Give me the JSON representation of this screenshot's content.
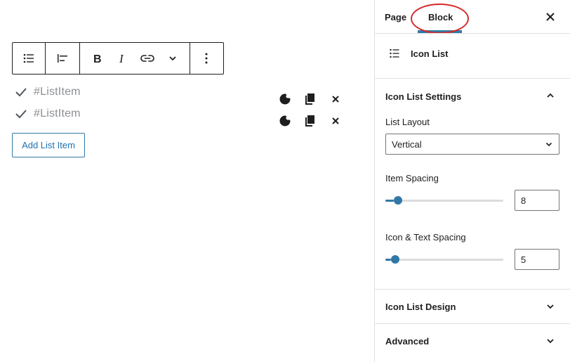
{
  "editor": {
    "list_items": [
      {
        "text": "#ListItem"
      },
      {
        "text": "#ListItem"
      }
    ],
    "add_button_label": "Add List Item"
  },
  "sidebar": {
    "tabs": [
      {
        "label": "Page",
        "active": false
      },
      {
        "label": "Block",
        "active": true
      }
    ],
    "block_name": "Icon List",
    "sections": {
      "settings": {
        "title": "Icon List Settings",
        "expanded": true,
        "list_layout": {
          "label": "List Layout",
          "value": "Vertical"
        },
        "item_spacing": {
          "label": "Item Spacing",
          "value": "8",
          "fraction": 0.07
        },
        "icon_text_spacing": {
          "label": "Icon & Text Spacing",
          "value": "5",
          "fraction": 0.05
        }
      },
      "design": {
        "title": "Icon List Design",
        "expanded": false
      },
      "advanced": {
        "title": "Advanced",
        "expanded": false
      }
    }
  },
  "colors": {
    "accent": "#3178a7",
    "highlight": "#d42b2b"
  }
}
